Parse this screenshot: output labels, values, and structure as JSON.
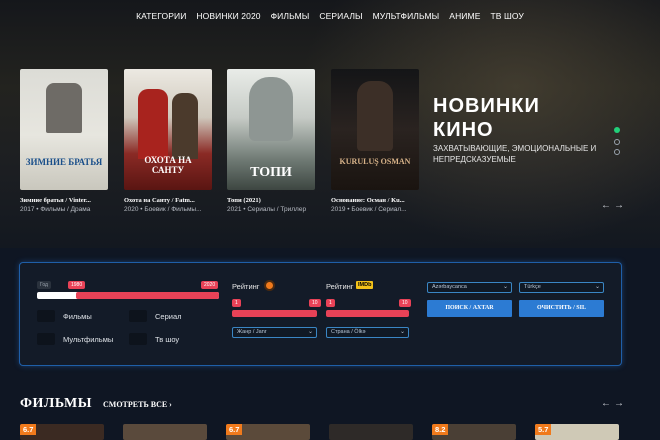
{
  "nav": [
    "КАТЕГОРИИ",
    "НОВИНКИ 2020",
    "ФИЛЬМЫ",
    "СЕРИАЛЫ",
    "МУЛЬТФИЛЬМЫ",
    "АНИМЕ",
    "ТВ ШОУ"
  ],
  "hero": {
    "title": "НОВИНКИ КИНО",
    "subtitle": "ЗАХВАТЫВАЮЩИЕ, ЭМОЦИОНАЛЬНЫЕ И НЕПРЕДСКАЗУЕМЫЕ",
    "slides": [
      {
        "title": "Зимние братья / Vinter...",
        "meta": "2017 • Фильмы / Драма",
        "poster_text": "ЗИМНИЕ БРАТЬЯ"
      },
      {
        "title": "Охота на Санту / Fatm...",
        "meta": "2020 • Боевик / Фильмы...",
        "poster_text": "ОХОТА НА САНТУ"
      },
      {
        "title": "Топи (2021)",
        "meta": "2021 • Сериалы / Триллер",
        "poster_text": "ТОПИ"
      },
      {
        "title": "Основание: Осман / Ku...",
        "meta": "2019 • Боевик / Сериал...",
        "poster_text": "KURULUŞ OSMAN"
      }
    ]
  },
  "filter": {
    "year_labels": [
      "Год",
      "1980",
      "2020"
    ],
    "checkboxes": [
      "Фильмы",
      "Сериал",
      "Мультфильмы",
      "Тв шоу"
    ],
    "rating_kp": {
      "label": "Рейтинг",
      "min": "1",
      "max": "10"
    },
    "rating_imdb": {
      "label": "Рейтинг",
      "badge": "IMDb",
      "min": "1",
      "max": "10"
    },
    "genre_select": "Жанр / Janr",
    "country_select": "Страна / Ölkə",
    "lang1": "Azərbaycanca",
    "lang2": "Türkçe",
    "search_btn": "ПОИСК / AXTAR",
    "clear_btn": "ОЧИСТИТЬ / SIL"
  },
  "movies": {
    "title": "ФИЛЬМЫ",
    "link": "СМОТРЕТЬ ВСЕ ›",
    "ratings": [
      "6.7",
      "",
      "6.7",
      "",
      "8.2",
      "5.7"
    ]
  }
}
